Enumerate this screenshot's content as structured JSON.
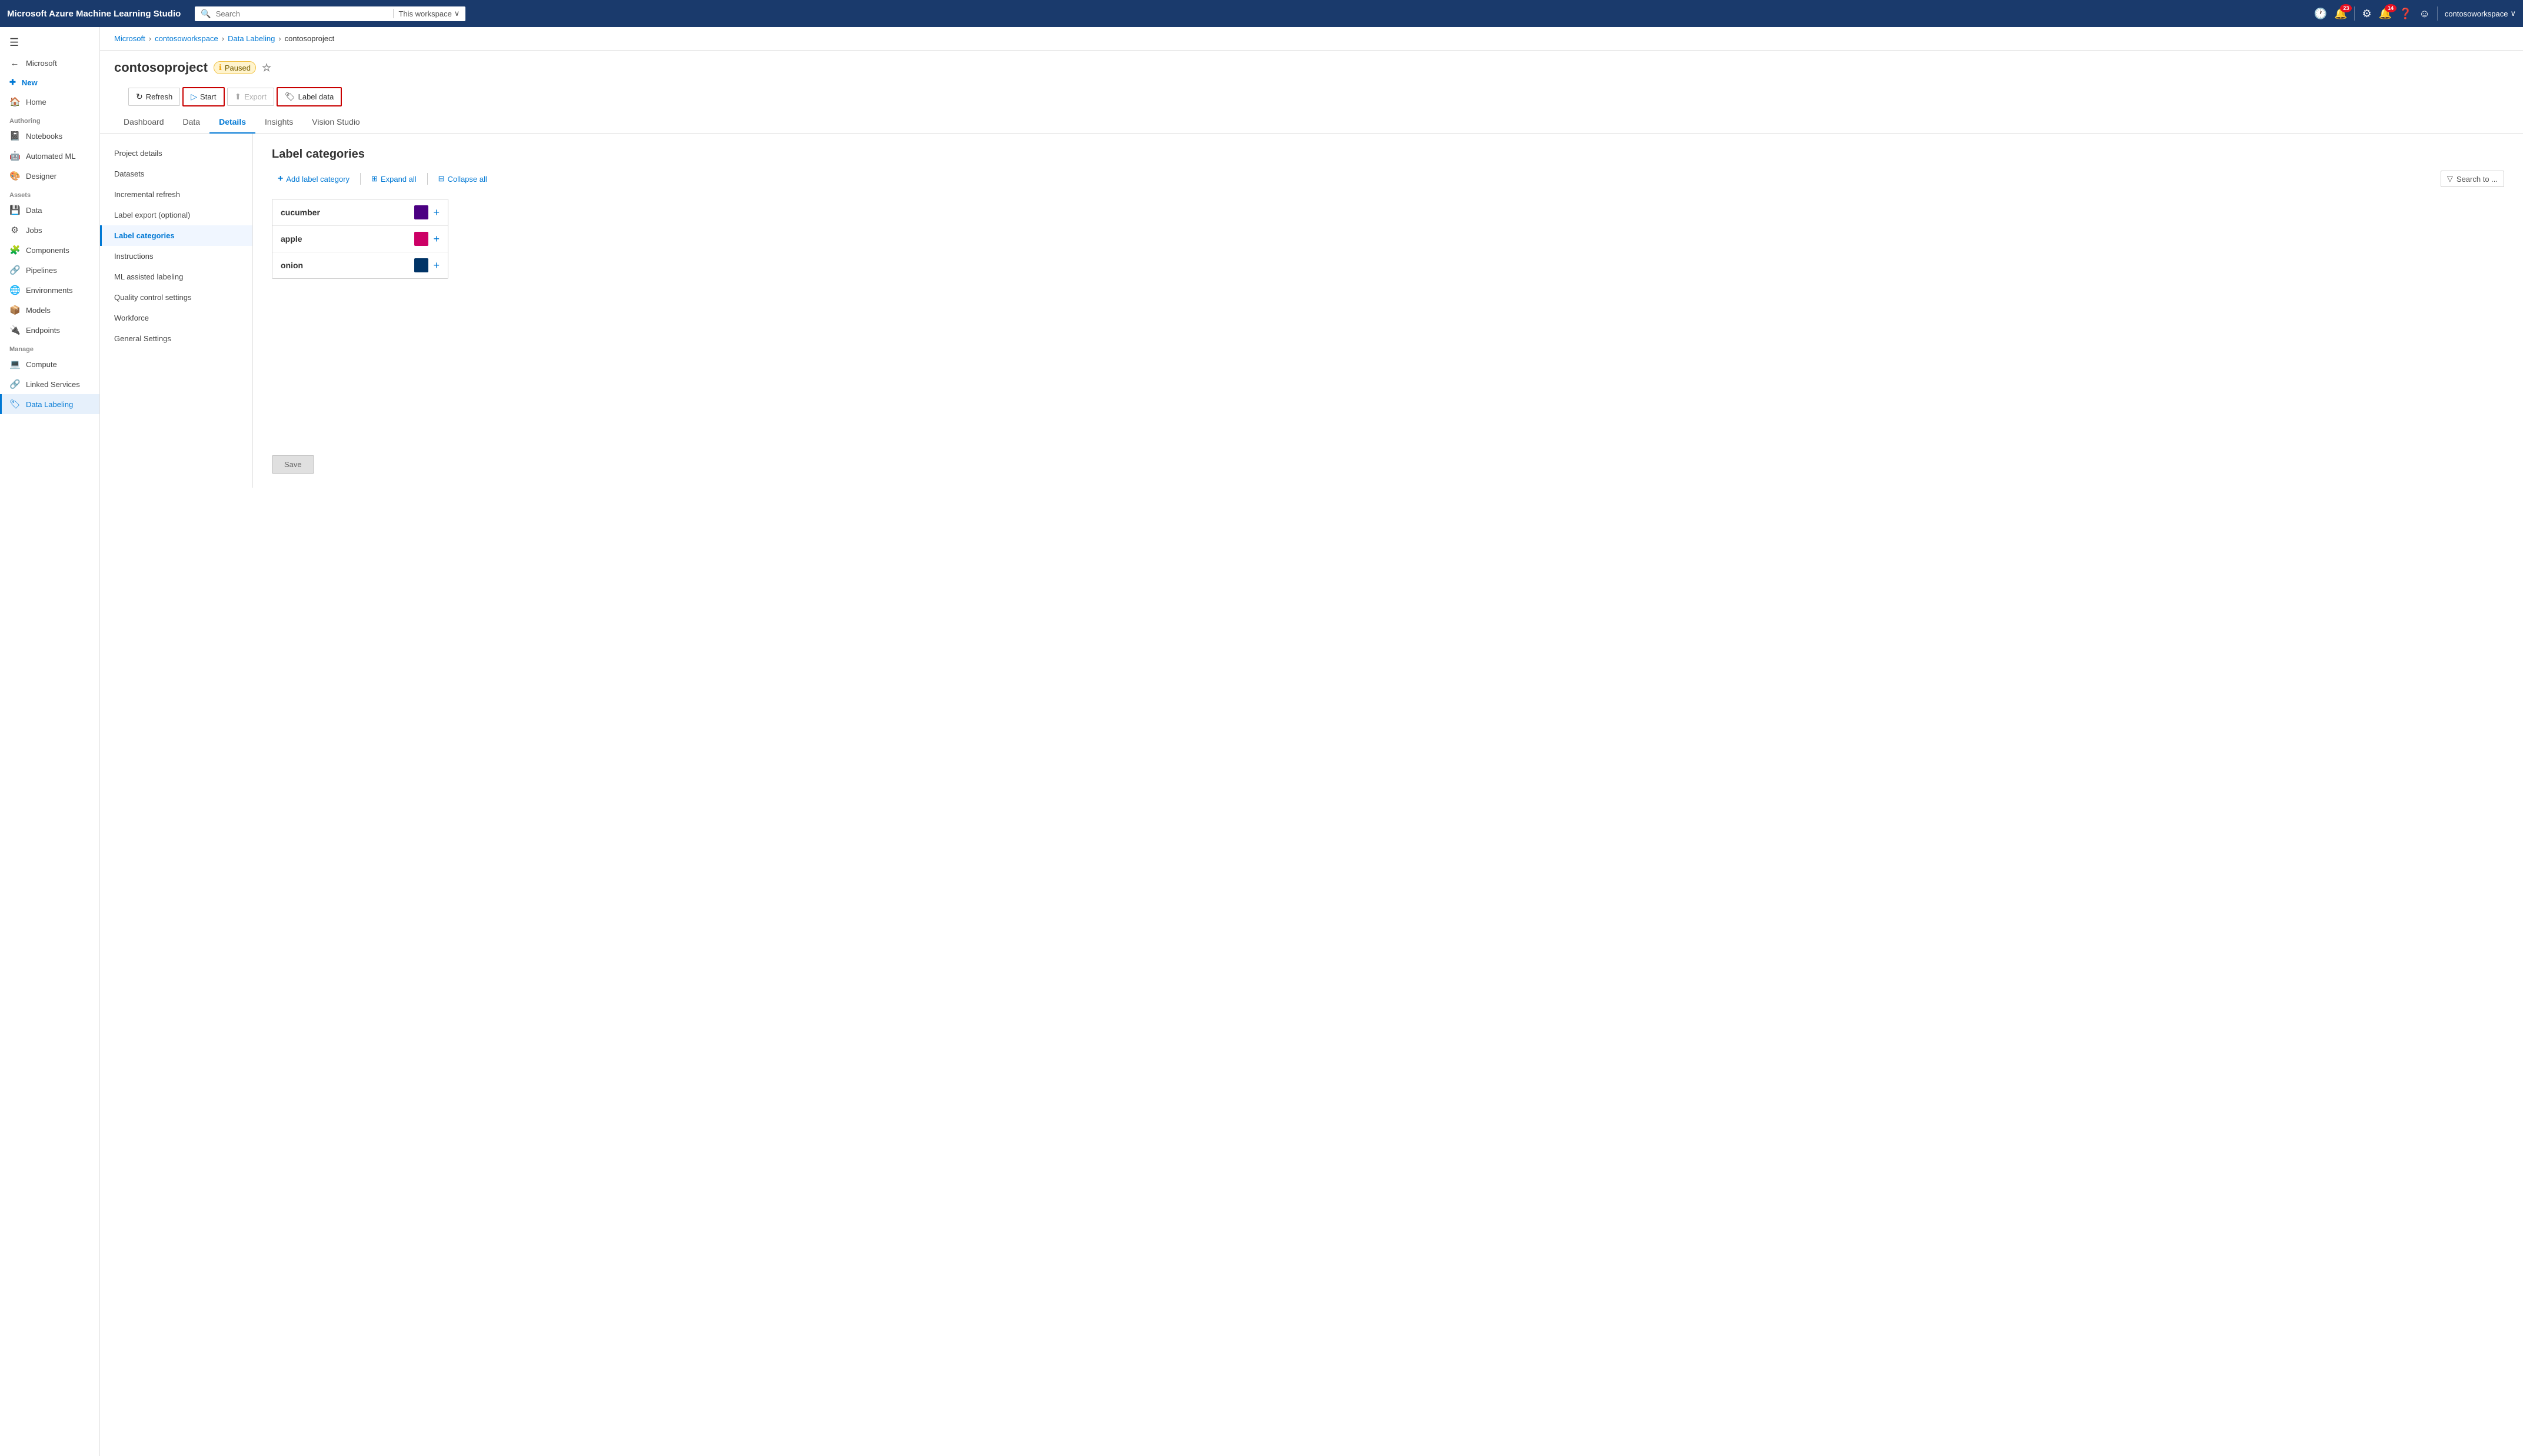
{
  "topbar": {
    "brand": "Microsoft Azure Machine Learning Studio",
    "search_placeholder": "Search",
    "search_scope": "This workspace",
    "icons": {
      "clock": "🕐",
      "notifications_badge": "23",
      "settings": "⚙",
      "alerts_badge": "14",
      "help": "?",
      "smiley": "☺"
    },
    "user": "contosoworkspace",
    "chevron": "∨"
  },
  "sidebar": {
    "hamburger": "☰",
    "back_label": "Microsoft",
    "new_label": "New",
    "items_authoring_section": "Authoring",
    "items_authoring": [
      {
        "icon": "📓",
        "label": "Notebooks"
      },
      {
        "icon": "🤖",
        "label": "Automated ML"
      },
      {
        "icon": "🎨",
        "label": "Designer"
      }
    ],
    "items_assets_section": "Assets",
    "items_assets": [
      {
        "icon": "💾",
        "label": "Data"
      },
      {
        "icon": "⚙",
        "label": "Jobs"
      },
      {
        "icon": "🧩",
        "label": "Components"
      },
      {
        "icon": "🔗",
        "label": "Pipelines"
      },
      {
        "icon": "🌐",
        "label": "Environments"
      },
      {
        "icon": "📦",
        "label": "Models"
      },
      {
        "icon": "🔌",
        "label": "Endpoints"
      }
    ],
    "items_manage_section": "Manage",
    "items_manage": [
      {
        "icon": "💻",
        "label": "Compute"
      },
      {
        "icon": "🔗",
        "label": "Linked Services"
      },
      {
        "icon": "🏷",
        "label": "Data Labeling",
        "active": true
      }
    ]
  },
  "breadcrumb": {
    "items": [
      "Microsoft",
      "contosoworkspace",
      "Data Labeling",
      "contosoproject"
    ],
    "separators": [
      ">",
      ">",
      ">"
    ]
  },
  "page": {
    "title": "contosoproject",
    "status": "Paused",
    "toolbar": {
      "refresh": "Refresh",
      "start": "Start",
      "export": "Export",
      "label_data": "Label data"
    },
    "tabs": [
      "Dashboard",
      "Data",
      "Details",
      "Insights",
      "Vision Studio"
    ],
    "active_tab": "Details"
  },
  "detail_nav": {
    "items": [
      "Project details",
      "Datasets",
      "Incremental refresh",
      "Label export (optional)",
      "Label categories",
      "Instructions",
      "ML assisted labeling",
      "Quality control settings",
      "Workforce",
      "General Settings"
    ],
    "active": "Label categories"
  },
  "label_categories": {
    "title": "Label categories",
    "toolbar": {
      "add": "Add label category",
      "expand": "Expand all",
      "collapse": "Collapse all",
      "search_placeholder": "Search to ..."
    },
    "items": [
      {
        "name": "cucumber",
        "color": "#4b0082"
      },
      {
        "name": "apple",
        "color": "#cc0066"
      },
      {
        "name": "onion",
        "color": "#003366"
      }
    ]
  },
  "save_button": "Save"
}
